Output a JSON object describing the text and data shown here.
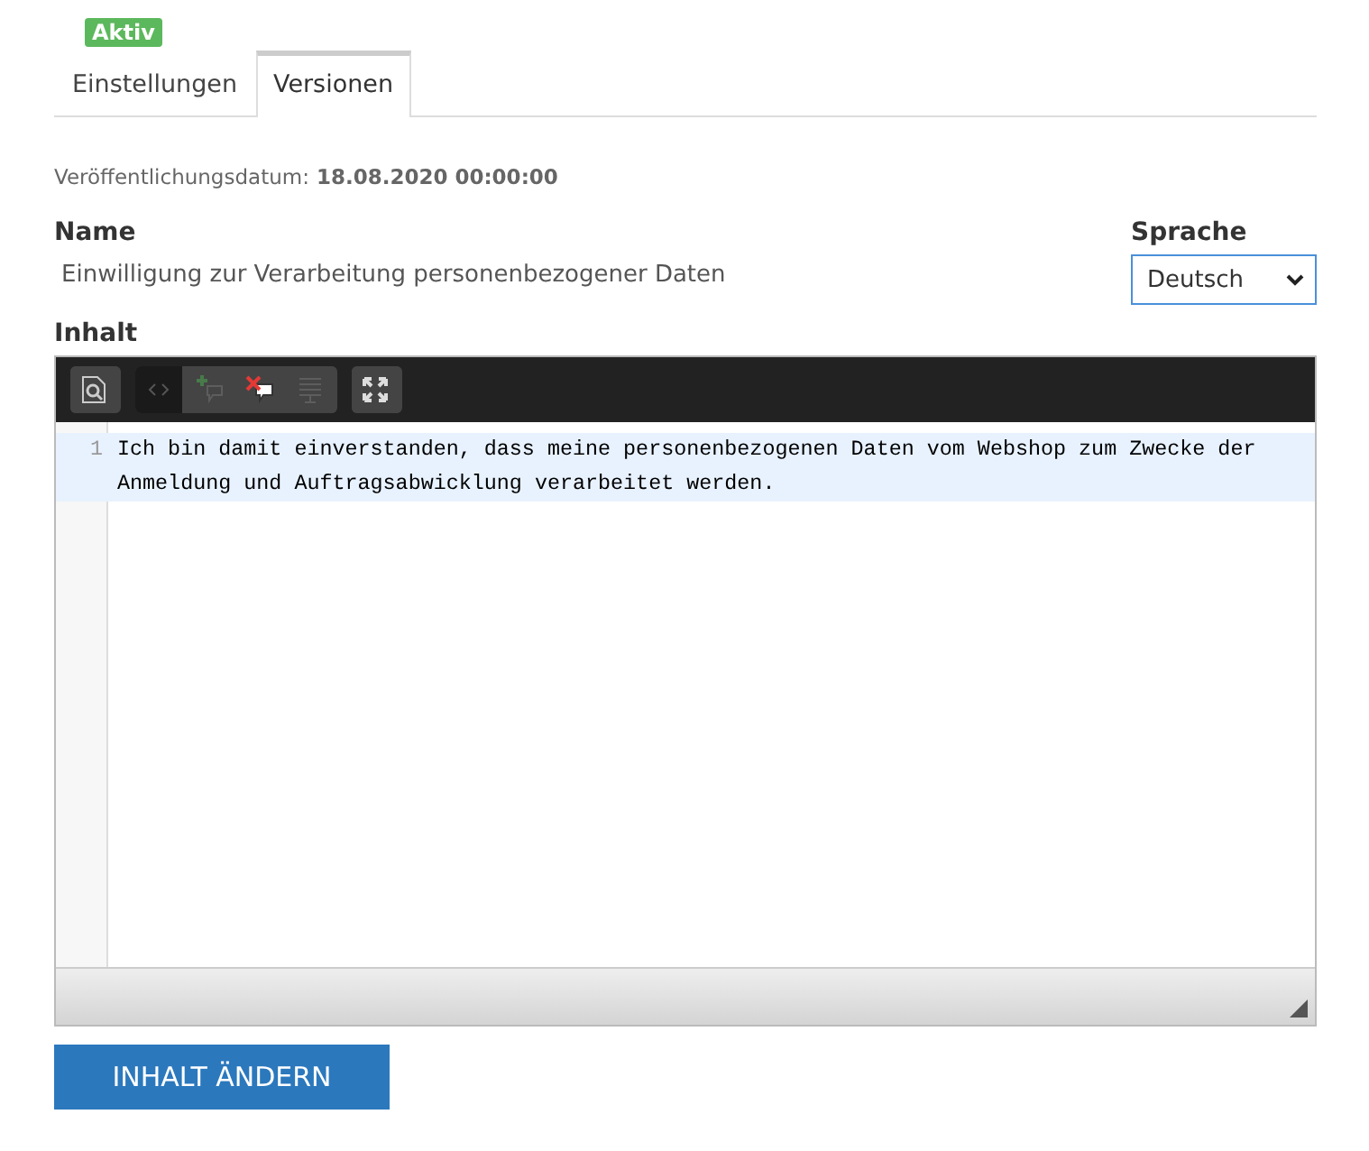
{
  "tabs": [
    {
      "label": "Einstellungen",
      "selected": false,
      "badge": "Aktiv"
    },
    {
      "label": "Versionen",
      "selected": true
    }
  ],
  "publish_date": {
    "label": "Veröffentlichungsdatum:",
    "value": "18.08.2020 00:00:00"
  },
  "name": {
    "label": "Name",
    "value": "Einwilligung zur Verarbeitung personenbezogener Daten"
  },
  "language": {
    "label": "Sprache",
    "value": "Deutsch"
  },
  "content": {
    "label": "Inhalt",
    "toolbar": [
      [
        {
          "kind": "preview",
          "selected": false,
          "disabled": false
        }
      ],
      [
        {
          "kind": "source",
          "selected": true,
          "disabled": false
        },
        {
          "kind": "add-comment",
          "selected": false,
          "disabled": true
        },
        {
          "kind": "remove-comments",
          "selected": false,
          "disabled": false
        },
        {
          "kind": "format",
          "selected": false,
          "disabled": true
        }
      ],
      [
        {
          "kind": "fullscreen",
          "selected": false,
          "disabled": false
        }
      ]
    ],
    "lines": [
      {
        "number": "1",
        "text": "Ich bin damit einverstanden, dass meine personenbezogenen Daten vom Webshop zum Zwecke der Anmeldung und Auftragsabwicklung verarbeitet werden."
      }
    ]
  },
  "button": "INHALT ÄNDERN"
}
